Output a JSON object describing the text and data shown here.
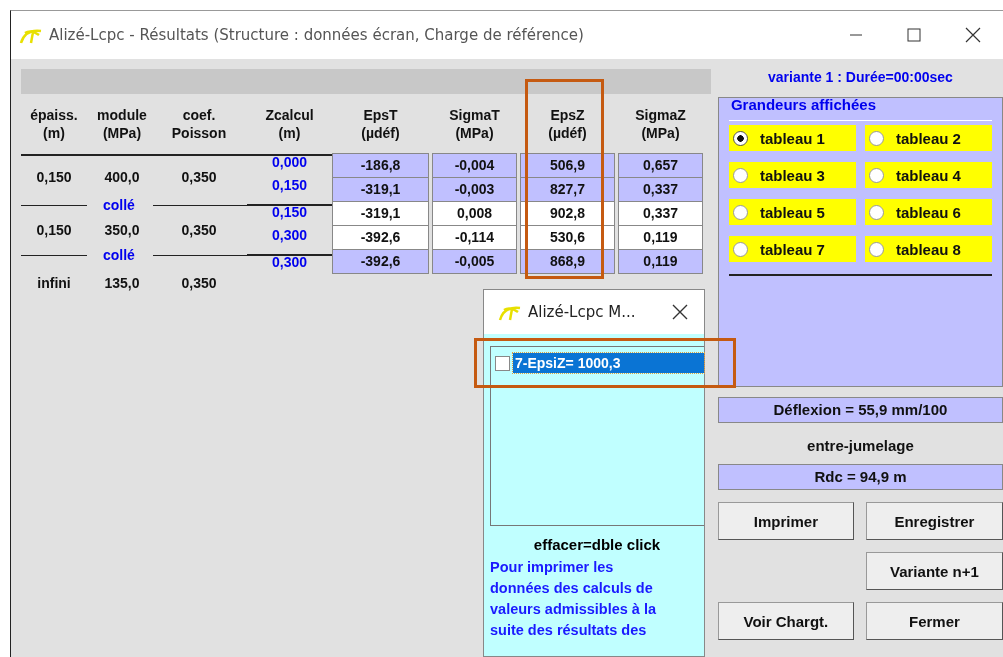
{
  "window": {
    "title": "Alizé-Lcpc - Résultats (Structure : données écran, Charge de référence)"
  },
  "layer_headers": [
    [
      "épaiss.",
      "(m)"
    ],
    [
      "module",
      "(MPa)"
    ],
    [
      "coef.",
      "Poisson"
    ]
  ],
  "layers": [
    {
      "thickness": "0,150",
      "modulus": "400,0",
      "poisson": "0,350",
      "interface": "collé"
    },
    {
      "thickness": "0,150",
      "modulus": "350,0",
      "poisson": "0,350",
      "interface": "collé"
    },
    {
      "thickness": "infini",
      "modulus": "135,0",
      "poisson": "0,350"
    }
  ],
  "zcalcul_header": [
    "Zcalcul",
    "(m)"
  ],
  "results": {
    "columns": [
      {
        "label": [
          "EpsT",
          "(µdéf)"
        ],
        "highlighted": false
      },
      {
        "label": [
          "SigmaT",
          "(MPa)"
        ],
        "highlighted": false
      },
      {
        "label": [
          "EpsZ",
          "(µdéf)"
        ],
        "highlighted": true
      },
      {
        "label": [
          "SigmaZ",
          "(MPa)"
        ],
        "highlighted": false
      }
    ],
    "rows": [
      {
        "zcalcul": "0,000",
        "shaded": true,
        "cells": [
          "-186,8",
          "-0,004",
          "506,9",
          "0,657"
        ]
      },
      {
        "zcalcul": "0,150",
        "shaded": true,
        "cells": [
          "-319,1",
          "-0,003",
          "827,7",
          "0,337"
        ]
      },
      {
        "zcalcul": "0,150",
        "shaded": false,
        "cells": [
          "-319,1",
          "0,008",
          "902,8",
          "0,337"
        ]
      },
      {
        "zcalcul": "0,300",
        "shaded": false,
        "cells": [
          "-392,6",
          "-0,114",
          "530,6",
          "0,119"
        ]
      },
      {
        "zcalcul": "0,300",
        "shaded": true,
        "cells": [
          "-392,6",
          "-0,005",
          "868,9",
          "0,119"
        ]
      }
    ]
  },
  "variant": "variante 1 : Durée=00:00sec",
  "display_group": {
    "title": "Grandeurs affichées",
    "options": [
      {
        "label": "tableau 1",
        "selected": true
      },
      {
        "label": "tableau 2",
        "selected": false
      },
      {
        "label": "tableau 3",
        "selected": false
      },
      {
        "label": "tableau 4",
        "selected": false
      },
      {
        "label": "tableau 5",
        "selected": false
      },
      {
        "label": "tableau 6",
        "selected": false
      },
      {
        "label": "tableau 7",
        "selected": false
      },
      {
        "label": "tableau 8",
        "selected": false
      }
    ]
  },
  "deflection": "Déflexion = 55,9 mm/100",
  "load_position": "entre-jumelage",
  "radius": "Rdc = 94,9 m",
  "buttons": [
    "Imprimer",
    "Enregistrer",
    "Variante n+1",
    "Voir Chargt.",
    "Fermer"
  ],
  "popup": {
    "title": "Alizé-Lcpc M...",
    "items": [
      {
        "label": "7-EpsiZ= 1000,3",
        "checked": false,
        "selected": true,
        "highlighted": true
      }
    ],
    "hint": "effacer=dble click",
    "note_lines": [
      "Pour imprimer les",
      "données des calculs de",
      "valeurs admissibles à la",
      "suite des résultats des"
    ]
  }
}
